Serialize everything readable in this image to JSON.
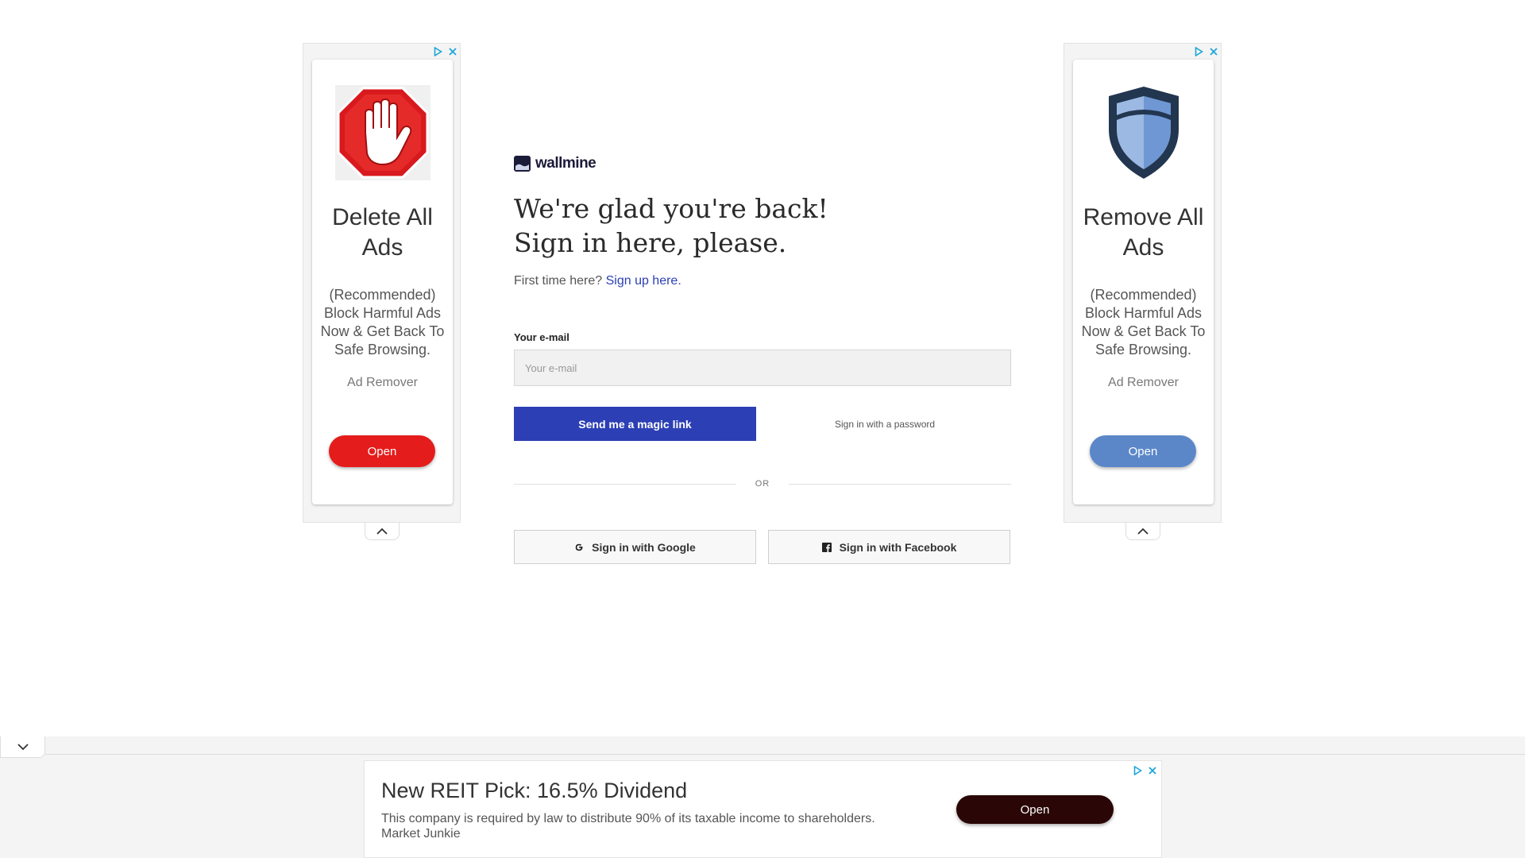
{
  "colors": {
    "brand_blue": "#2c3fb5",
    "ad_open_red": "#e51c1c",
    "ad_open_blue": "#5b87c9",
    "bottom_open_dark": "#2a0606"
  },
  "left_ad": {
    "icon": "stop-hand-icon",
    "title": "Delete All Ads",
    "description": "(Recommended) Block Harmful Ads Now & Get Back To Safe Browsing.",
    "brand": "Ad Remover",
    "open_label": "Open"
  },
  "right_ad": {
    "icon": "shield-icon",
    "title": "Remove All Ads",
    "description": "(Recommended) Block Harmful Ads Now & Get Back To Safe Browsing.",
    "brand": "Ad Remover",
    "open_label": "Open"
  },
  "signin": {
    "brand_name": "wallmine",
    "headline_line1": "We're glad you're back!",
    "headline_line2": "Sign in here, please.",
    "first_time_text": "First time here?",
    "signup_link": "Sign up here",
    "signup_period": ".",
    "email_label": "Your e-mail",
    "email_placeholder": "Your e-mail",
    "email_value": "",
    "magic_link_button": "Send me a magic link",
    "password_link": "Sign in with a password",
    "or_text": "OR",
    "google_button": "Sign in with Google",
    "facebook_button": "Sign in with Facebook"
  },
  "bottom_ad": {
    "title": "New REIT Pick: 16.5% Dividend",
    "description": "This company is required by law to distribute 90% of its taxable income to shareholders.",
    "brand": "Market Junkie",
    "open_label": "Open"
  }
}
